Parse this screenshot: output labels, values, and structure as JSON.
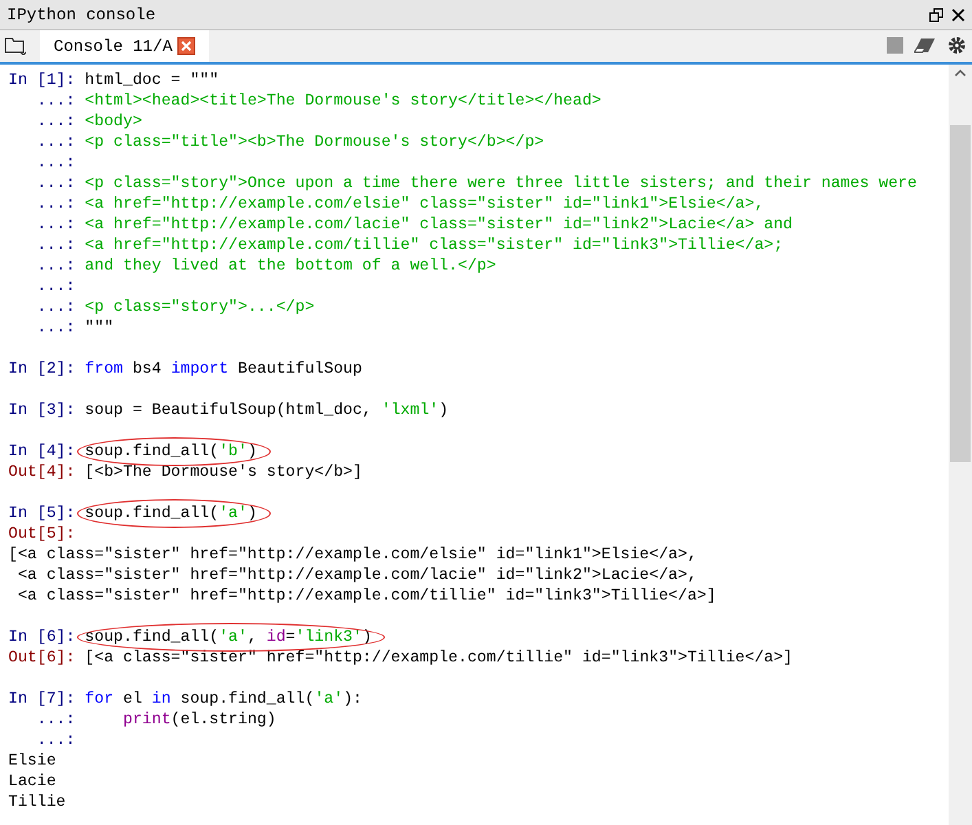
{
  "window": {
    "title": "IPython console"
  },
  "tabs": [
    {
      "label": "Console 11/A",
      "selected": true
    }
  ],
  "console": [
    {
      "kind": "in",
      "prompt": "In [1]: ",
      "tokens": [
        {
          "text": "html_doc = \"\"\"",
          "kind": "plain"
        }
      ]
    },
    {
      "kind": "cont",
      "prompt": "   ...: ",
      "tokens": [
        {
          "text": "<html><head><title>The Dormouse's story</title></head>",
          "kind": "string"
        }
      ]
    },
    {
      "kind": "cont",
      "prompt": "   ...: ",
      "tokens": [
        {
          "text": "<body>",
          "kind": "string"
        }
      ]
    },
    {
      "kind": "cont",
      "prompt": "   ...: ",
      "tokens": [
        {
          "text": "<p class=\"title\"><b>The Dormouse's story</b></p>",
          "kind": "string"
        }
      ]
    },
    {
      "kind": "cont",
      "prompt": "   ...:"
    },
    {
      "kind": "cont",
      "prompt": "   ...: ",
      "tokens": [
        {
          "text": "<p class=\"story\">Once upon a time there were three little sisters; and their names were",
          "kind": "string"
        }
      ]
    },
    {
      "kind": "cont",
      "prompt": "   ...: ",
      "tokens": [
        {
          "text": "<a href=\"http://example.com/elsie\" class=\"sister\" id=\"link1\">Elsie</a>,",
          "kind": "string"
        }
      ]
    },
    {
      "kind": "cont",
      "prompt": "   ...: ",
      "tokens": [
        {
          "text": "<a href=\"http://example.com/lacie\" class=\"sister\" id=\"link2\">Lacie</a> and",
          "kind": "string"
        }
      ]
    },
    {
      "kind": "cont",
      "prompt": "   ...: ",
      "tokens": [
        {
          "text": "<a href=\"http://example.com/tillie\" class=\"sister\" id=\"link3\">Tillie</a>;",
          "kind": "string"
        }
      ]
    },
    {
      "kind": "cont",
      "prompt": "   ...: ",
      "tokens": [
        {
          "text": "and they lived at the bottom of a well.</p>",
          "kind": "string"
        }
      ]
    },
    {
      "kind": "cont",
      "prompt": "   ...:"
    },
    {
      "kind": "cont",
      "prompt": "   ...: ",
      "tokens": [
        {
          "text": "<p class=\"story\">...</p>",
          "kind": "string"
        }
      ]
    },
    {
      "kind": "cont",
      "prompt": "   ...: ",
      "tokens": [
        {
          "text": "\"\"\"",
          "kind": "plain"
        }
      ]
    },
    {
      "kind": "blank"
    },
    {
      "kind": "in",
      "prompt": "In [2]: ",
      "tokens": [
        {
          "text": "from",
          "kind": "keyword"
        },
        {
          "text": " bs4 ",
          "kind": "plain"
        },
        {
          "text": "import",
          "kind": "keyword"
        },
        {
          "text": " BeautifulSoup",
          "kind": "plain"
        }
      ]
    },
    {
      "kind": "blank"
    },
    {
      "kind": "in",
      "prompt": "In [3]: ",
      "tokens": [
        {
          "text": "soup = BeautifulSoup(html_doc, ",
          "kind": "plain"
        },
        {
          "text": "'lxml'",
          "kind": "string"
        },
        {
          "text": ")",
          "kind": "plain"
        }
      ]
    },
    {
      "kind": "blank"
    },
    {
      "kind": "in",
      "prompt": "In [4]: ",
      "circled": true,
      "tokens": [
        {
          "text": "soup.find_all(",
          "kind": "plain"
        },
        {
          "text": "'b'",
          "kind": "string"
        },
        {
          "text": ")",
          "kind": "plain"
        }
      ]
    },
    {
      "kind": "out",
      "prompt": "Out[4]: ",
      "tokens": [
        {
          "text": "[<b>The Dormouse's story</b>]",
          "kind": "plain"
        }
      ]
    },
    {
      "kind": "blank"
    },
    {
      "kind": "in",
      "prompt": "In [5]: ",
      "circled": true,
      "tokens": [
        {
          "text": "soup.find_all(",
          "kind": "plain"
        },
        {
          "text": "'a'",
          "kind": "string"
        },
        {
          "text": ")",
          "kind": "plain"
        }
      ]
    },
    {
      "kind": "out",
      "prompt": "Out[5]:"
    },
    {
      "kind": "text",
      "tokens": [
        {
          "text": "[<a class=\"sister\" href=\"http://example.com/elsie\" id=\"link1\">Elsie</a>,",
          "kind": "plain"
        }
      ]
    },
    {
      "kind": "text",
      "tokens": [
        {
          "text": " <a class=\"sister\" href=\"http://example.com/lacie\" id=\"link2\">Lacie</a>,",
          "kind": "plain"
        }
      ]
    },
    {
      "kind": "text",
      "tokens": [
        {
          "text": " <a class=\"sister\" href=\"http://example.com/tillie\" id=\"link3\">Tillie</a>]",
          "kind": "plain"
        }
      ]
    },
    {
      "kind": "blank"
    },
    {
      "kind": "in",
      "prompt": "In [6]: ",
      "circled": true,
      "tokens": [
        {
          "text": "soup.find_all(",
          "kind": "plain"
        },
        {
          "text": "'a'",
          "kind": "string"
        },
        {
          "text": ", ",
          "kind": "plain"
        },
        {
          "text": "id",
          "kind": "builtin"
        },
        {
          "text": "=",
          "kind": "plain"
        },
        {
          "text": "'link3'",
          "kind": "string"
        },
        {
          "text": ")",
          "kind": "plain"
        }
      ]
    },
    {
      "kind": "out",
      "prompt": "Out[6]: ",
      "tokens": [
        {
          "text": "[<a class=\"sister\" href=\"http://example.com/tillie\" id=\"link3\">Tillie</a>]",
          "kind": "plain"
        }
      ]
    },
    {
      "kind": "blank"
    },
    {
      "kind": "in",
      "prompt": "In [7]: ",
      "tokens": [
        {
          "text": "for",
          "kind": "keyword"
        },
        {
          "text": " el ",
          "kind": "plain"
        },
        {
          "text": "in",
          "kind": "keyword"
        },
        {
          "text": " soup.find_all(",
          "kind": "plain"
        },
        {
          "text": "'a'",
          "kind": "string"
        },
        {
          "text": "):",
          "kind": "plain"
        }
      ]
    },
    {
      "kind": "cont",
      "prompt": "   ...: ",
      "tokens": [
        {
          "text": "    print",
          "kind": "builtin"
        },
        {
          "text": "(el.string)",
          "kind": "plain"
        }
      ]
    },
    {
      "kind": "cont",
      "prompt": "   ...:"
    },
    {
      "kind": "text",
      "tokens": [
        {
          "text": "Elsie",
          "kind": "plain"
        }
      ]
    },
    {
      "kind": "text",
      "tokens": [
        {
          "text": "Lacie",
          "kind": "plain"
        }
      ]
    },
    {
      "kind": "text",
      "tokens": [
        {
          "text": "Tillie",
          "kind": "plain"
        }
      ]
    }
  ]
}
